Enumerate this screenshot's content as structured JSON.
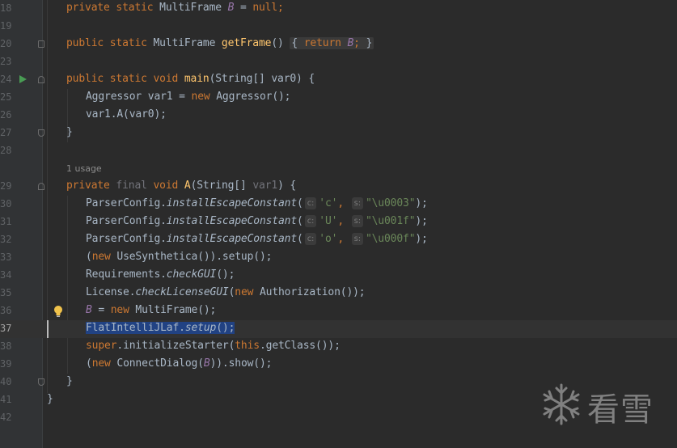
{
  "lines": [
    {
      "n": "18"
    },
    {
      "n": "19"
    },
    {
      "n": "20"
    },
    {
      "n": "23"
    },
    {
      "n": "24"
    },
    {
      "n": "25"
    },
    {
      "n": "26"
    },
    {
      "n": "27"
    },
    {
      "n": "28"
    },
    {
      "n": "29"
    },
    {
      "n": "30"
    },
    {
      "n": "31"
    },
    {
      "n": "32"
    },
    {
      "n": "33"
    },
    {
      "n": "34"
    },
    {
      "n": "35"
    },
    {
      "n": "36"
    },
    {
      "n": "37"
    },
    {
      "n": "38"
    },
    {
      "n": "39"
    },
    {
      "n": "40"
    },
    {
      "n": "41"
    },
    {
      "n": "42"
    }
  ],
  "code": {
    "l18": {
      "kw": "private static",
      "type": " MultiFrame ",
      "field": "B",
      "rest": " = ",
      "null": "null",
      "end": ";"
    },
    "l20": {
      "kw": "public static",
      "type": " MultiFrame ",
      "fn": "getFrame",
      "paren": "() ",
      "open": "{ ",
      "ret": "return ",
      "field": "B",
      "semi": ";",
      "close": " }"
    },
    "l24": {
      "kw": "public static void ",
      "fn": "main",
      "rest": "(String[] var0) {"
    },
    "l25": {
      "a": "Aggressor var1 = ",
      "kw": "new",
      "b": " Aggressor();"
    },
    "l26": {
      "a": "var1.A(var0);"
    },
    "l27": {
      "a": "}"
    },
    "usage": "1 usage",
    "l29": {
      "kw1": "private ",
      "final": "final ",
      "kw2": "void ",
      "fn": "A",
      "a": "(String[] ",
      "param": "var1",
      "b": ") {"
    },
    "l30": {
      "a": "ParserConfig.",
      "m": "installEscapeConstant",
      "p": "(",
      "h1": "c:",
      "s1": "'c'",
      "comma": ", ",
      "h2": "s:",
      "s2": "\"\\u0003\"",
      "end": ");"
    },
    "l31": {
      "a": "ParserConfig.",
      "m": "installEscapeConstant",
      "p": "(",
      "h1": "c:",
      "s1": "'U'",
      "comma": ", ",
      "h2": "s:",
      "s2": "\"\\u001f\"",
      "end": ");"
    },
    "l32": {
      "a": "ParserConfig.",
      "m": "installEscapeConstant",
      "p": "(",
      "h1": "c:",
      "s1": "'o'",
      "comma": ", ",
      "h2": "s:",
      "s2": "\"\\u000f\"",
      "end": ");"
    },
    "l33": {
      "a": "(",
      "kw": "new",
      "b": " UseSynthetica()).setup();"
    },
    "l34": {
      "a": "Requirements.",
      "m": "checkGUI",
      "b": "();"
    },
    "l35": {
      "a": "License.",
      "m": "checkLicenseGUI",
      "b": "(",
      "kw": "new",
      "c": " Authorization());"
    },
    "l36": {
      "field": "B",
      "a": " = ",
      "kw": "new",
      "b": " MultiFrame();"
    },
    "l37": {
      "a": "FlatIntelliJLaf.",
      "m": "setup",
      "b": "();"
    },
    "l38": {
      "kw": "super",
      "a": ".initializeStarter(",
      "kw2": "this",
      "b": ".getClass());"
    },
    "l39": {
      "a": "(",
      "kw": "new",
      "b": " ConnectDialog(",
      "field": "B",
      "c": ")).show();"
    },
    "l40": {
      "a": "}"
    },
    "l41": {
      "a": "}"
    }
  },
  "watermark": {
    "text": "看雪"
  },
  "colors": {
    "background": "#2b2b2b",
    "keyword": "#cc7832",
    "method": "#ffc66d",
    "static_field": "#9876aa",
    "string": "#6a8759",
    "selection": "#214283"
  },
  "icons": {
    "run": "run-gutter-icon",
    "bulb": "intention-bulb-icon",
    "fold": "fold-marker-icon",
    "snowflake": "snowflake-logo-icon"
  }
}
